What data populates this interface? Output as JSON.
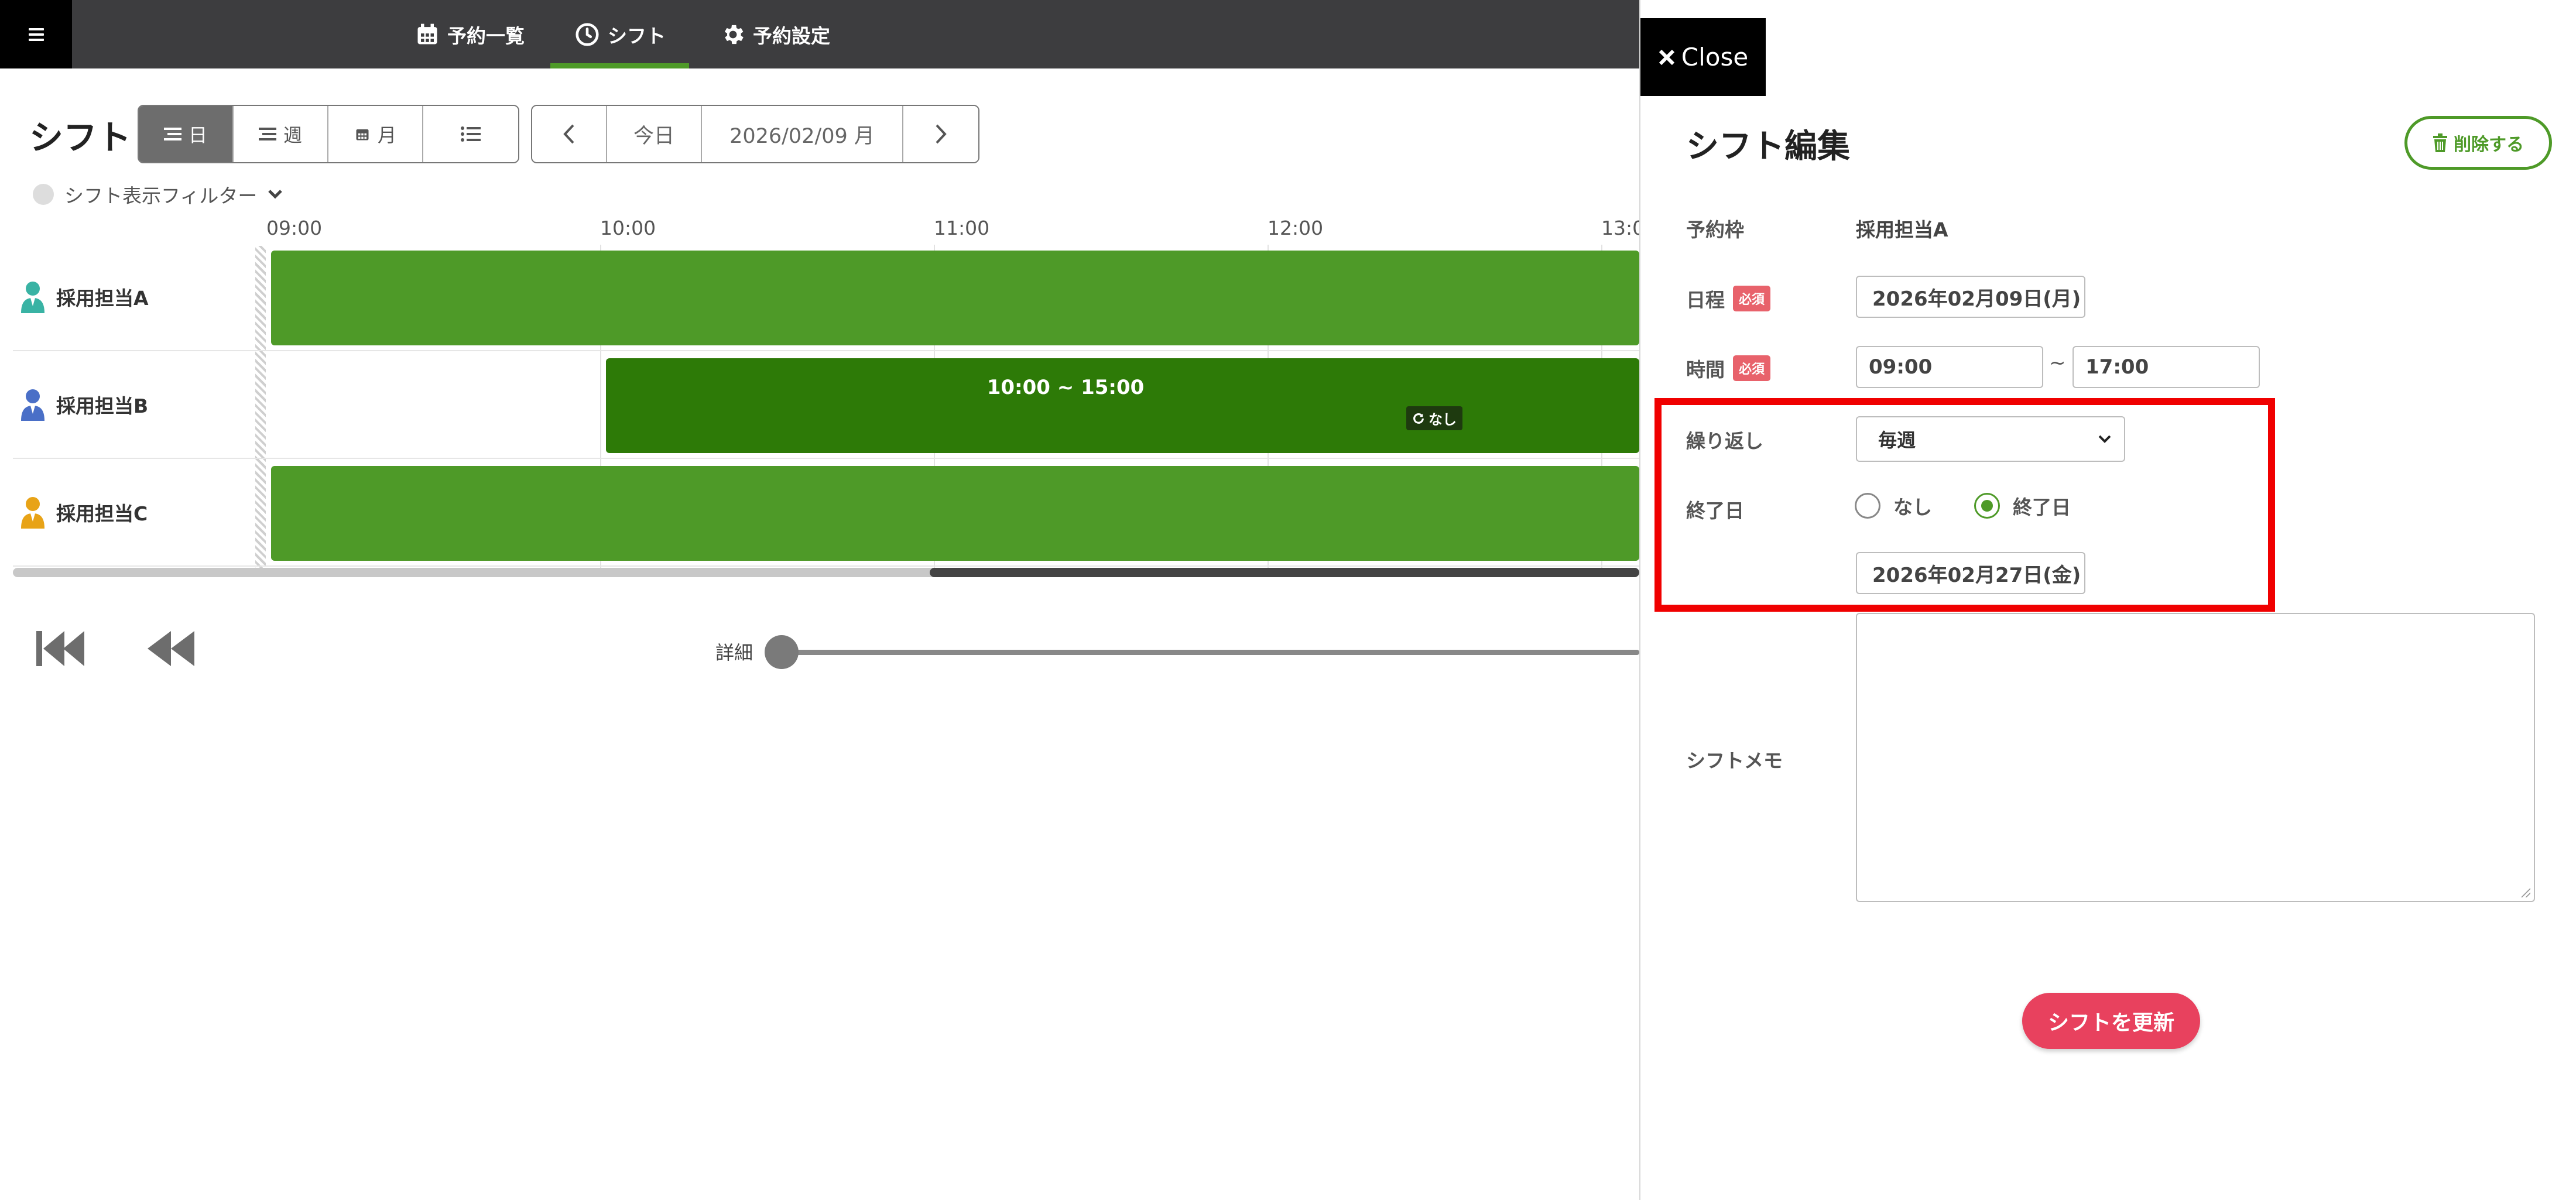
{
  "nav": {
    "tabs": [
      {
        "label": "予約一覧",
        "icon": "calendar-icon"
      },
      {
        "label": "シフト",
        "icon": "clock-icon"
      },
      {
        "label": "予約設定",
        "icon": "gear-icon"
      }
    ],
    "active_tab": "シフト"
  },
  "toolbar": {
    "title": "シフト",
    "views": [
      {
        "label": "日",
        "icon": "list-icon"
      },
      {
        "label": "週",
        "icon": "list-icon"
      },
      {
        "label": "月",
        "icon": "calendar-icon"
      },
      {
        "label": "",
        "icon": "bullet-list-icon"
      }
    ],
    "active_view": "日",
    "today_label": "今日",
    "current_date": "2026/02/09 月",
    "filter_label": "シフト表示フィルター"
  },
  "timeline": {
    "hours": [
      "09:00",
      "10:00",
      "11:00",
      "12:00",
      "13:0"
    ],
    "rows": [
      {
        "name": "採用担当A",
        "icon": "person-icon",
        "icon_color": "#39b3a4"
      },
      {
        "name": "採用担当B",
        "icon": "person-icon",
        "icon_color": "#4a6fc7"
      },
      {
        "name": "採用担当C",
        "icon": "person-icon",
        "icon_color": "#e8a317"
      }
    ],
    "shift_b": {
      "time": "10:00 ~ 15:00",
      "repeat_badge": "なし"
    },
    "colors": {
      "shift": "#4e9a28",
      "shift_selected": "#2d7a07"
    }
  },
  "playback": {
    "detail_label": "詳細"
  },
  "panel": {
    "close_label": "Close",
    "title": "シフト編集",
    "delete_label": "削除する",
    "required_badge": "必須",
    "fields": {
      "slot_label": "予約枠",
      "slot_value": "採用担当A",
      "date_label": "日程",
      "date_value": "2026年02月09日(月)",
      "time_label": "時間",
      "time_start": "09:00",
      "time_sep": "~",
      "time_end": "17:00",
      "repeat_label": "繰り返し",
      "repeat_value": "毎週",
      "end_label": "終了日",
      "end_option_none": "なし",
      "end_option_date": "終了日",
      "end_date_value": "2026年02月27日(金)",
      "memo_label": "シフトメモ",
      "memo_value": ""
    },
    "submit_label": "シフトを更新",
    "colors": {
      "accent": "#4e9a28",
      "submit": "#e8415e",
      "required": "#e8626b",
      "highlight": "#f00000"
    }
  }
}
